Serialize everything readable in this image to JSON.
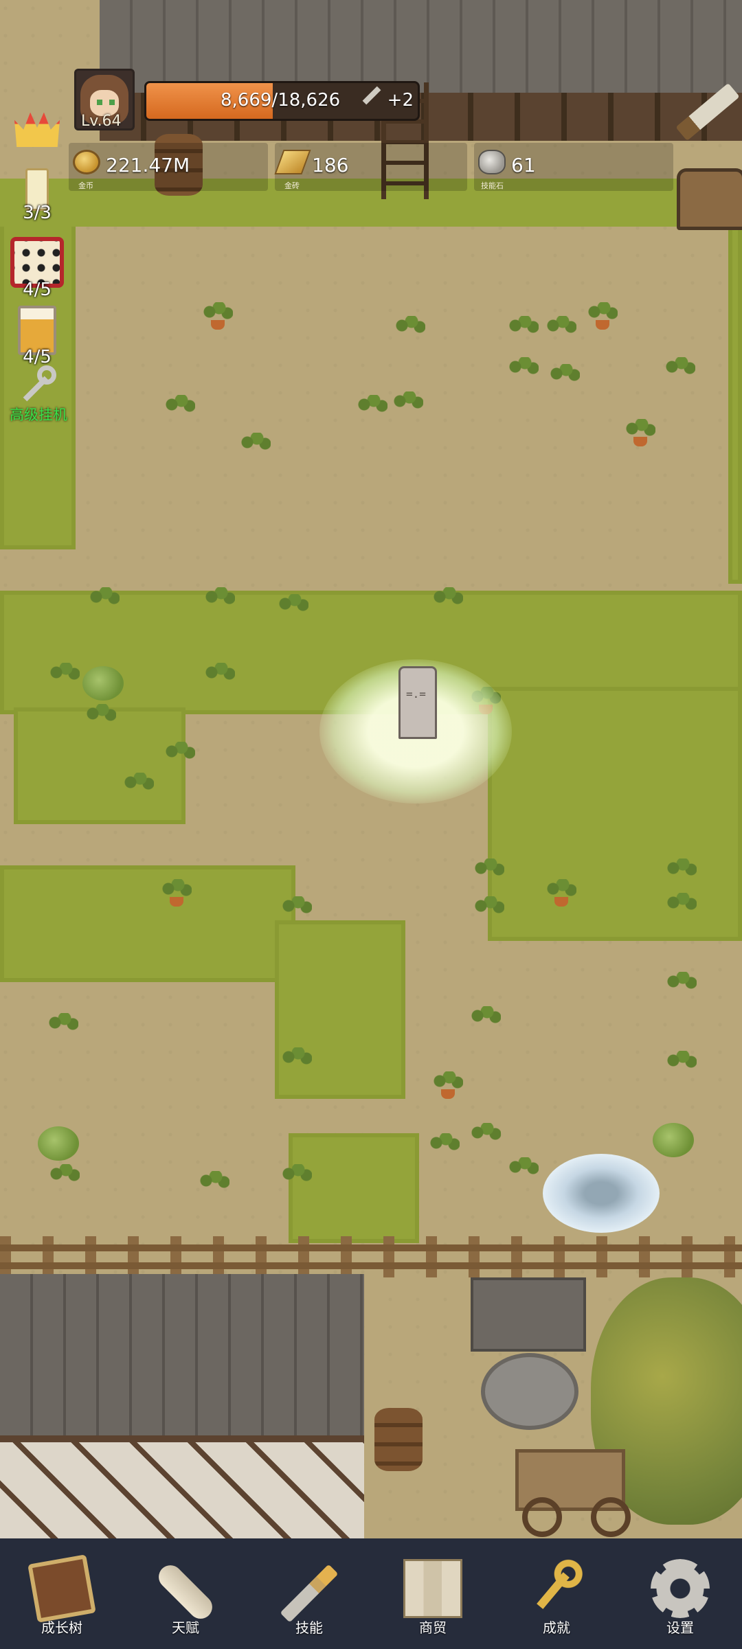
{
  "player": {
    "level_label": "Lv.64",
    "exp_text": "8,669/18,626",
    "exp_progress": 0.4654,
    "exp_bonus": "+2"
  },
  "resources": [
    {
      "value": "221.47M",
      "caption": "金币",
      "icon": "gold-coin-icon"
    },
    {
      "value": "186",
      "caption": "金砖",
      "icon": "gold-bar-icon"
    },
    {
      "value": "61",
      "caption": "技能石",
      "icon": "skill-stone-icon"
    }
  ],
  "side_buttons": [
    {
      "icon": "crown-icon",
      "count": ""
    },
    {
      "icon": "candle-icon",
      "count": "3/3"
    },
    {
      "icon": "dice-icon",
      "count": "4/5"
    },
    {
      "icon": "beer-icon",
      "count": "4/5"
    },
    {
      "icon": "key-icon",
      "label": "高级挂机"
    }
  ],
  "nav": [
    {
      "label": "成长树",
      "icon": "book-icon"
    },
    {
      "label": "天赋",
      "icon": "scroll-icon"
    },
    {
      "label": "技能",
      "icon": "sword-icon"
    },
    {
      "label": "商贸",
      "icon": "map-icon"
    },
    {
      "label": "成就",
      "icon": "gold-key-icon"
    },
    {
      "label": "设置",
      "icon": "gear-icon"
    }
  ]
}
